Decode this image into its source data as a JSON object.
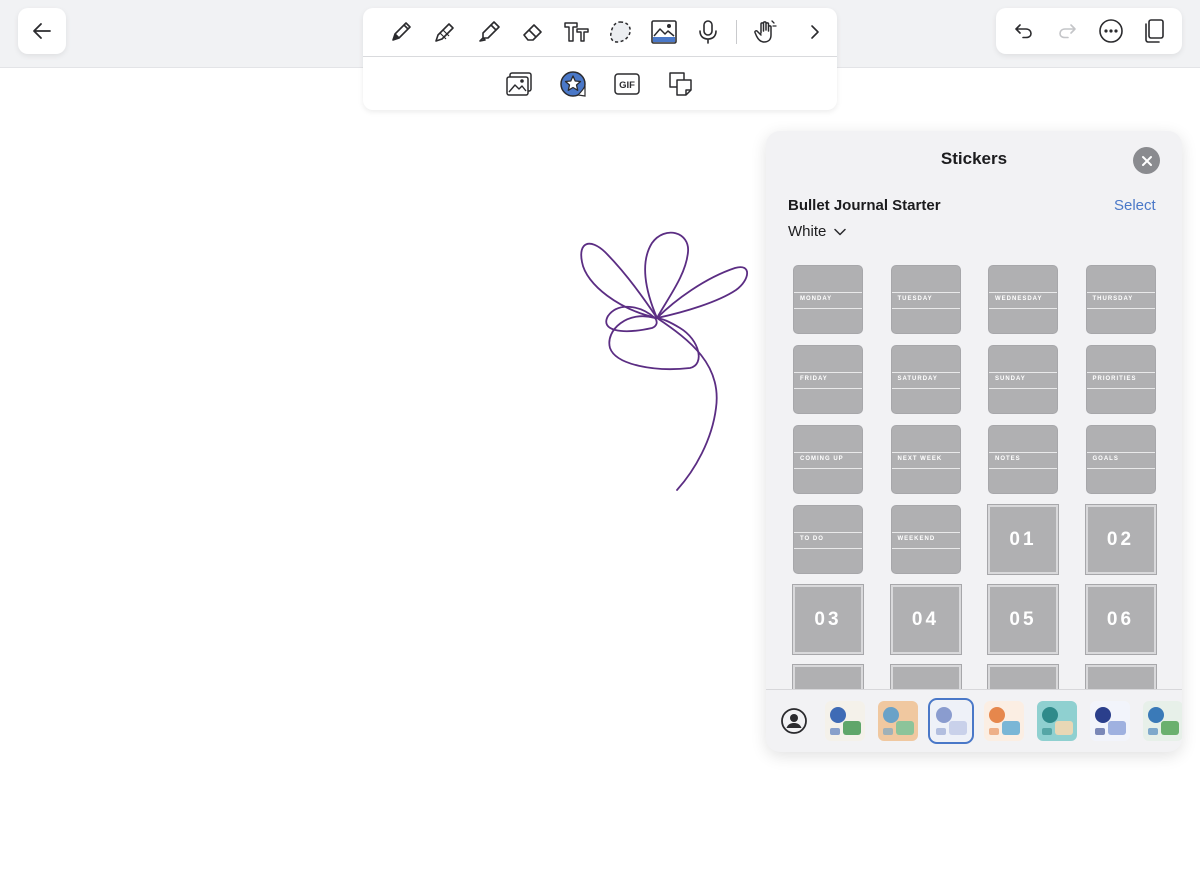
{
  "toolbar": {
    "tools": [
      "pen-icon",
      "pencil-icon",
      "highlighter-icon",
      "eraser-icon",
      "text-icon",
      "lasso-icon",
      "image-icon",
      "microphone-icon",
      "touch-icon",
      "chevron-right-icon"
    ],
    "secondary_tools": [
      "photo-icon",
      "sticker-icon",
      "gif-icon",
      "sticky-note-icon"
    ],
    "gif_label": "GIF"
  },
  "right_toolbar": {
    "icons": [
      "undo-icon",
      "redo-icon",
      "more-icon",
      "pages-icon"
    ]
  },
  "panel": {
    "title": "Stickers",
    "pack_name": "Bullet Journal Starter",
    "select_label": "Select",
    "variant": "White",
    "stickers": [
      {
        "type": "tab",
        "label": "MONDAY"
      },
      {
        "type": "tab",
        "label": "TUESDAY"
      },
      {
        "type": "tab",
        "label": "WEDNESDAY"
      },
      {
        "type": "tab",
        "label": "THURSDAY"
      },
      {
        "type": "tab",
        "label": "FRIDAY"
      },
      {
        "type": "tab",
        "label": "SATURDAY"
      },
      {
        "type": "tab",
        "label": "SUNDAY"
      },
      {
        "type": "tab",
        "label": "PRIORITIES"
      },
      {
        "type": "tab",
        "label": "COMING UP"
      },
      {
        "type": "tab",
        "label": "NEXT WEEK"
      },
      {
        "type": "tab",
        "label": "NOTES"
      },
      {
        "type": "tab",
        "label": "GOALS"
      },
      {
        "type": "tab",
        "label": "TO DO"
      },
      {
        "type": "tab",
        "label": "WEEKEND"
      },
      {
        "type": "num",
        "label": "01"
      },
      {
        "type": "num",
        "label": "02"
      },
      {
        "type": "num",
        "label": "03"
      },
      {
        "type": "num",
        "label": "04"
      },
      {
        "type": "num",
        "label": "05"
      },
      {
        "type": "num",
        "label": "06"
      },
      {
        "type": "num",
        "label": ""
      },
      {
        "type": "num",
        "label": ""
      },
      {
        "type": "num",
        "label": ""
      },
      {
        "type": "num",
        "label": ""
      }
    ],
    "packs": [
      {
        "name": "pack-doodles",
        "colors": [
          "#f4f1ea",
          "#3f6bb5",
          "#5fa66a"
        ]
      },
      {
        "name": "pack-landscape",
        "colors": [
          "#f0c8a0",
          "#6aa2c8",
          "#8cc49a"
        ]
      },
      {
        "name": "pack-bullet-journal",
        "colors": [
          "#eef1f8",
          "#8a9ccf",
          "#c9d1ea"
        ]
      },
      {
        "name": "pack-food",
        "colors": [
          "#fbeee3",
          "#e6874c",
          "#7ab6d6"
        ]
      },
      {
        "name": "pack-storefront",
        "colors": [
          "#8fd0d0",
          "#2f8a8a",
          "#e8d7b5"
        ]
      },
      {
        "name": "pack-stationery",
        "colors": [
          "#f2f4fb",
          "#2b3f8c",
          "#9fb1e0"
        ]
      },
      {
        "name": "pack-planet",
        "colors": [
          "#e7f0e9",
          "#3a7ab8",
          "#6ab06e"
        ]
      }
    ],
    "active_pack": 2
  },
  "colors": {
    "ink": "#5b2d83",
    "accent": "#4a78c8",
    "sticker_gray": "#b0b0b2"
  }
}
